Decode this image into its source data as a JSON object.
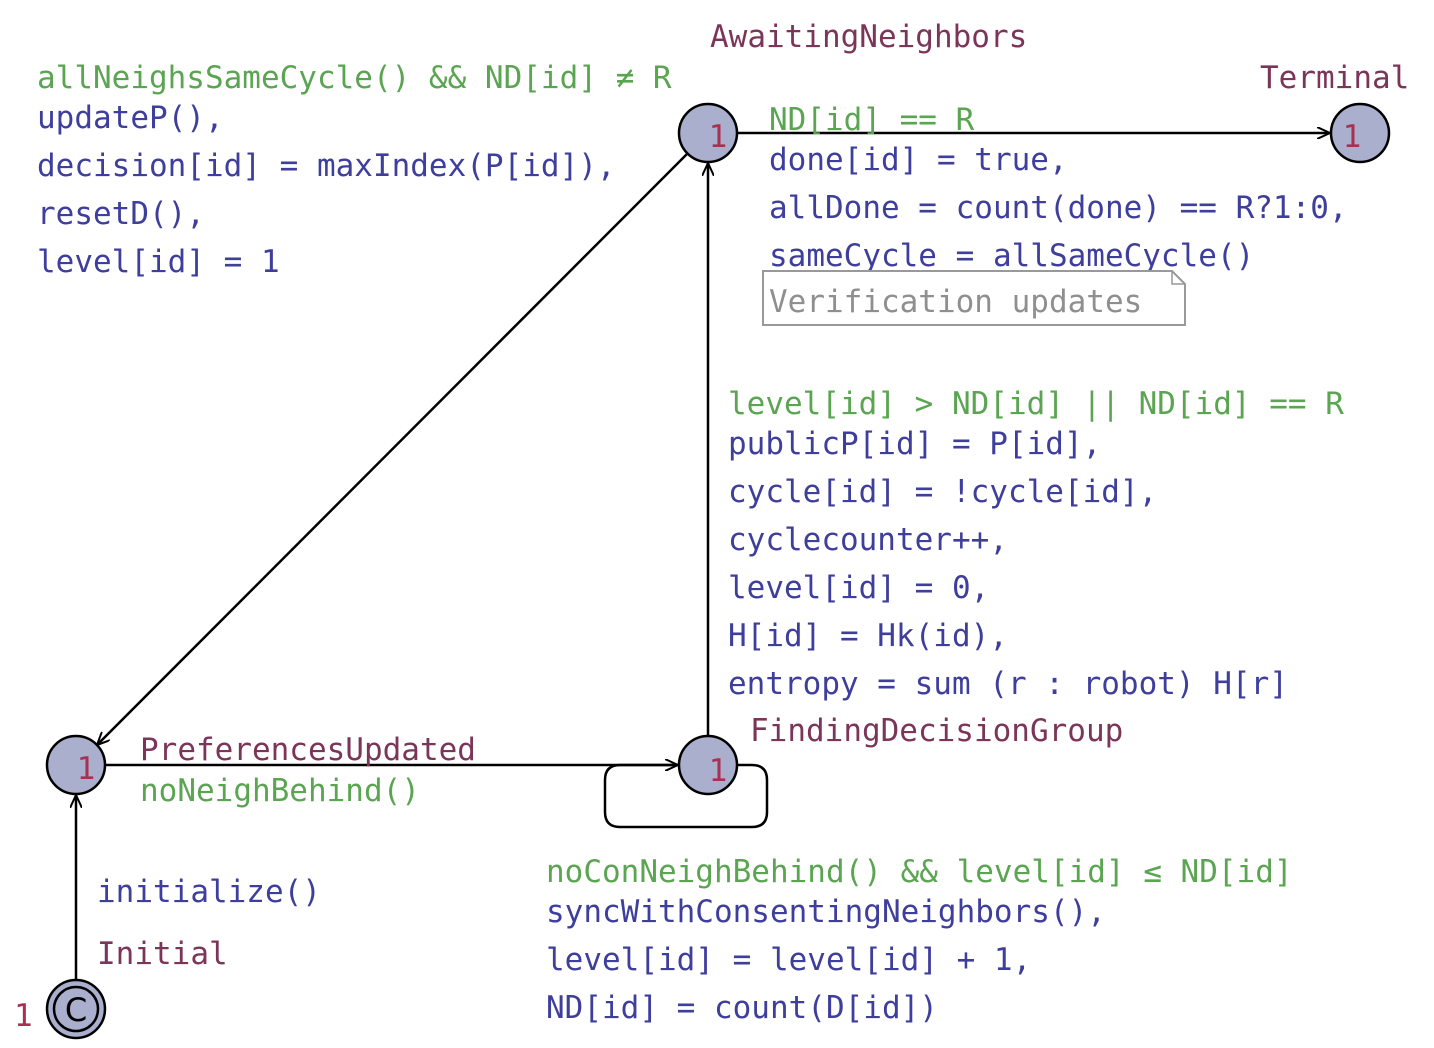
{
  "locations": {
    "awaiting": {
      "name": "AwaitingNeighbors",
      "count": "1"
    },
    "terminal": {
      "name": "Terminal",
      "count": "1"
    },
    "preferences": {
      "name": "PreferencesUpdated",
      "count": "1"
    },
    "finding": {
      "name": "FindingDecisionGroup",
      "count": "1"
    },
    "initial": {
      "name": "Initial",
      "count": "1",
      "committed_symbol": "C"
    }
  },
  "edges": {
    "awaiting_to_preferences": {
      "guard": "allNeighsSameCycle() && ND[id] ≠ R",
      "updates": [
        "updateP(),",
        "decision[id] = maxIndex(P[id]),",
        "resetD(),",
        "level[id] = 1"
      ]
    },
    "awaiting_to_terminal": {
      "guard": "ND[id] == R",
      "updates": [
        "done[id] = true,",
        "allDone = count(done) == R?1:0,",
        "sameCycle = allSameCycle()"
      ],
      "note": "Verification updates"
    },
    "finding_to_awaiting": {
      "guard": "level[id] > ND[id] || ND[id] == R",
      "updates": [
        "publicP[id] = P[id],",
        "cycle[id] = !cycle[id],",
        "cyclecounter++,",
        "level[id] = 0,",
        "H[id] = Hk(id),",
        "entropy = sum (r : robot) H[r]"
      ]
    },
    "preferences_to_finding": {
      "guard": "noNeighBehind()"
    },
    "finding_self_loop": {
      "guard": "noConNeighBehind() && level[id] ≤ ND[id]",
      "updates": [
        "syncWithConsentingNeighbors(),",
        "level[id] = level[id] + 1,",
        "ND[id] = count(D[id])"
      ]
    },
    "initial_to_preferences": {
      "updates": [
        "initialize()"
      ]
    }
  },
  "colors": {
    "guard": "#5ba552",
    "update": "#3e3e9c",
    "name": "#7b3559",
    "count": "#a83050",
    "node_fill": "#a9afcc"
  }
}
